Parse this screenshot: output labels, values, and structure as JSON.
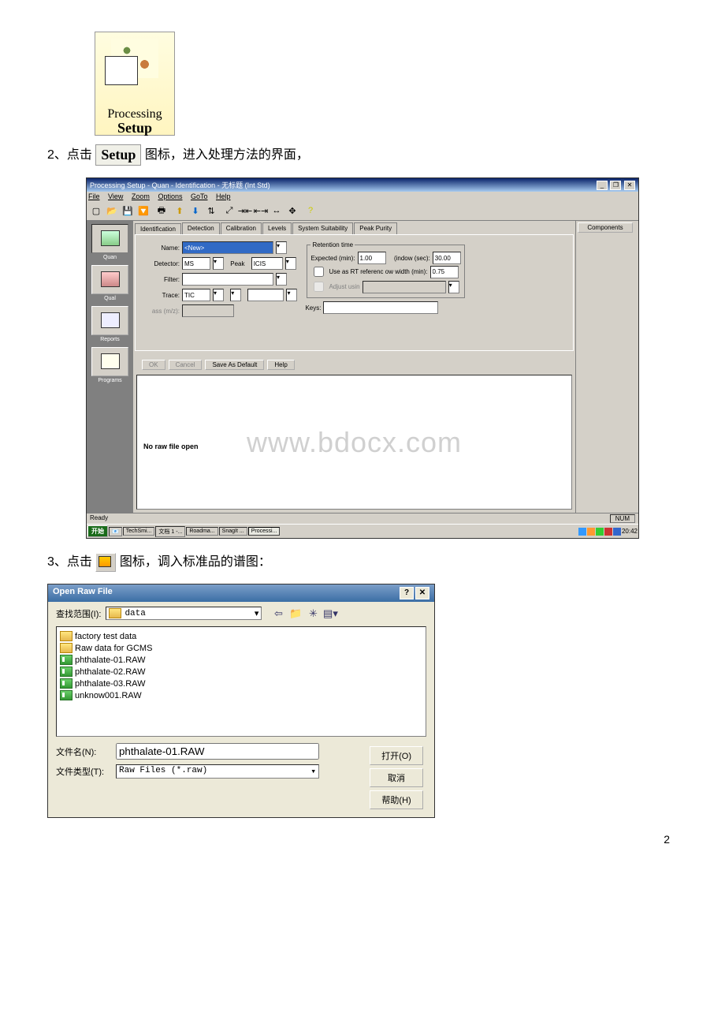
{
  "step2": {
    "prefix": "2、点击",
    "suffix": "图标，进入处理方法的界面，",
    "setup": "Setup",
    "proc": "Processing"
  },
  "win": {
    "title": "Processing Setup - Quan - Identification - 无标题 (Int Std)",
    "menu": [
      "File",
      "View",
      "Zoom",
      "Options",
      "GoTo",
      "Help"
    ],
    "sidebar": [
      {
        "l": "Quan"
      },
      {
        "l": "Qual"
      },
      {
        "l": "Reports"
      },
      {
        "l": "Programs"
      }
    ],
    "tabs": [
      "Identification",
      "Detection",
      "Calibration",
      "Levels",
      "System Suitability",
      "Peak Purity"
    ],
    "form": {
      "name_l": "Name:",
      "name_v": "<New>",
      "det_l": "Detector:",
      "det_v": "MS",
      "peak_l": "Peak",
      "peak_v": "ICIS",
      "filter_l": "Filter:",
      "trace_l": "Trace:",
      "trace_v": "TIC",
      "mass_l": "ass (m/z):",
      "rt_legend": "Retention time",
      "exp_l": "Expected (min):",
      "exp_v": "1.00",
      "win_l": "(indow (sec):",
      "win_v": "30.00",
      "use_l": "Use as RT referenc  ow width (min):",
      "use_v": "0.75",
      "adj_l": "Adjust usin",
      "keys_l": "Keys:"
    },
    "buttons": {
      "ok": "OK",
      "cancel": "Cancel",
      "save": "Save As Default",
      "help": "Help"
    },
    "components": "Components",
    "nofile": "No raw file open",
    "watermark": "www.bdocx.com",
    "status": "Ready",
    "num": "NUM",
    "taskbar": {
      "start": "开始",
      "tasks": [
        "TechSmi...",
        "文档 1 -...",
        "Roadma...",
        "SnagIt ...",
        "Processi..."
      ],
      "time": "20:42"
    }
  },
  "step3": {
    "prefix": "3、点击",
    "suffix": "图标，调入标准品的谱图："
  },
  "dialog": {
    "title": "Open Raw File",
    "lookin_l": "查找范围(I):",
    "lookin_v": "data",
    "files": [
      {
        "t": "folder",
        "n": "factory test data"
      },
      {
        "t": "folder",
        "n": "Raw data for GCMS"
      },
      {
        "t": "raw",
        "n": "phthalate-01.RAW"
      },
      {
        "t": "raw",
        "n": "phthalate-02.RAW"
      },
      {
        "t": "raw",
        "n": "phthalate-03.RAW"
      },
      {
        "t": "raw",
        "n": "unknow001.RAW"
      }
    ],
    "fname_l": "文件名(N):",
    "fname_v": "phthalate-01.RAW",
    "ftype_l": "文件类型(T):",
    "ftype_v": "Raw Files (*.raw)",
    "open": "打开(O)",
    "cancel": "取消",
    "help": "帮助(H)"
  },
  "pagenum": "2"
}
